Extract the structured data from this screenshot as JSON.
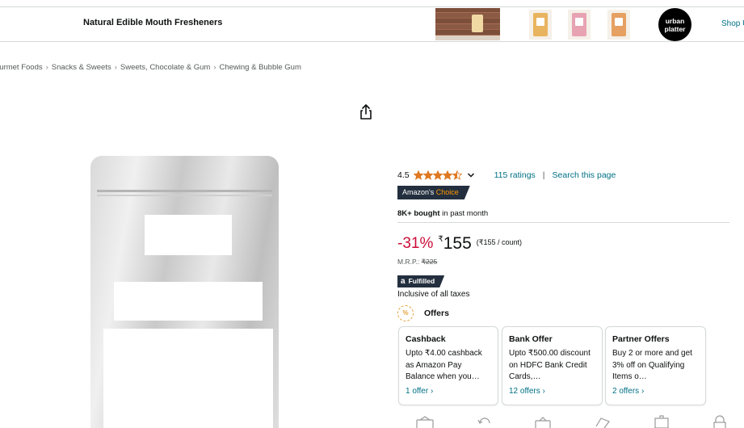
{
  "brand_bar": {
    "title": "Natural Edible Mouth Fresheners",
    "logo_text_line1": "urban",
    "logo_text_line2": "platter",
    "shop_link": "Shop U"
  },
  "breadcrumb": [
    "ourmet Foods",
    "Snacks & Sweets",
    "Sweets, Chocolate & Gum",
    "Chewing & Bubble Gum"
  ],
  "breadcrumb_sep": "›",
  "rating": {
    "value": "4.5",
    "stars": 4.5,
    "ratings_link": "115 ratings",
    "divider": "|",
    "search_link": "Search this page"
  },
  "badge": {
    "prefix": "Amazon's",
    "accent": "Choice"
  },
  "bought": {
    "bold": "8K+ bought",
    "rest": " in past month"
  },
  "price": {
    "discount": "-31%",
    "currency": "₹",
    "amount": "155",
    "unit_price": "(₹155 / count)",
    "mrp_label": "M.R.P.:",
    "mrp_value": "₹225"
  },
  "fulfilled": {
    "glyph": "a",
    "label": "Fulfilled"
  },
  "taxes": "Inclusive of all taxes",
  "offers": {
    "icon_text": "%",
    "title": "Offers",
    "cards": [
      {
        "title": "Cashback",
        "desc": "Upto ₹4.00 cashback as Amazon Pay Balance when you…",
        "more": "1 offer ›"
      },
      {
        "title": "Bank Offer",
        "desc": "Upto ₹500.00 discount on HDFC Bank Credit Cards,…",
        "more": "12 offers ›"
      },
      {
        "title": "Partner Offers",
        "desc": "Buy 2 or more and get 3% off on Qualifying Items o…",
        "more": "2 offers ›"
      }
    ]
  },
  "colors": {
    "link": "#007185",
    "discount": "#CC0C39",
    "star": "#DE7921",
    "badge_bg": "#232F3E",
    "badge_accent": "#FF9900"
  }
}
